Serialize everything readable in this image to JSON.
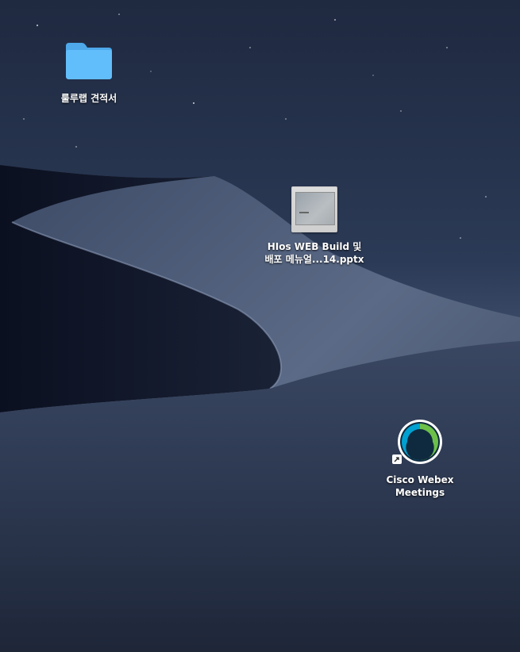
{
  "desktop": {
    "icons": [
      {
        "label_lines": [
          "룰루랩 견적서"
        ]
      },
      {
        "label_lines": [
          "HIos WEB Build 및",
          "배포 메뉴얼...14.pptx"
        ]
      },
      {
        "label_lines": [
          "Cisco Webex",
          "Meetings"
        ]
      }
    ]
  },
  "colors": {
    "sky": "#2b3a55",
    "folder": "#5cb5f5"
  }
}
